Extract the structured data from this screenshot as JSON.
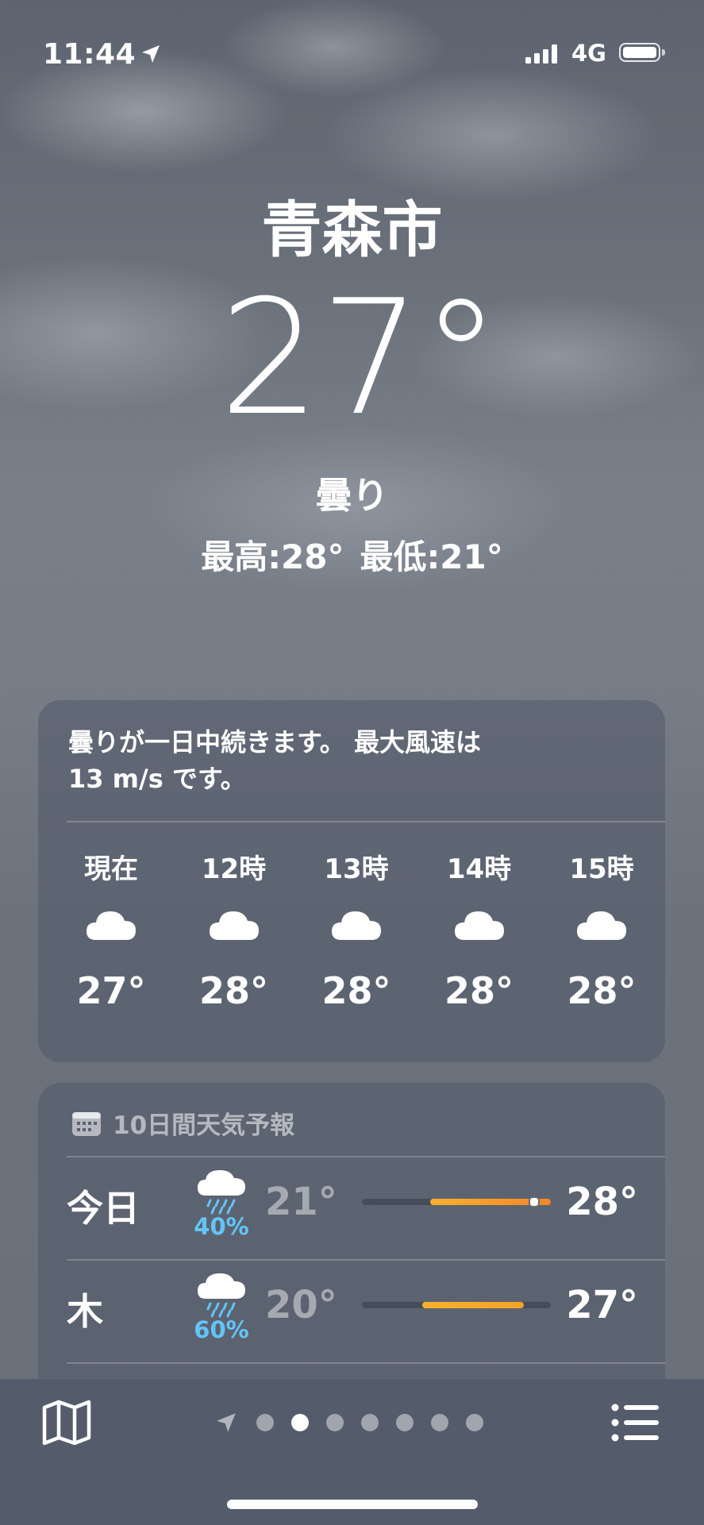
{
  "status_bar": {
    "time": "11:44",
    "network": "4G"
  },
  "location": {
    "city": "青森市",
    "temperature": "27°",
    "condition": "曇り",
    "high": "最高:28°",
    "low": "最低:21°"
  },
  "hourly_card": {
    "summary_line1": "曇りが一日中続きます。 最大風速は",
    "summary_line2": "13 m/s です。",
    "hours": [
      {
        "label": "現在",
        "icon": "cloud-icon",
        "temp": "27°"
      },
      {
        "label": "12時",
        "icon": "cloud-icon",
        "temp": "28°"
      },
      {
        "label": "13時",
        "icon": "cloud-icon",
        "temp": "28°"
      },
      {
        "label": "14時",
        "icon": "cloud-icon",
        "temp": "28°"
      },
      {
        "label": "15時",
        "icon": "cloud-icon",
        "temp": "28°"
      }
    ]
  },
  "forecast_card": {
    "title": "10日間天気予報",
    "days": [
      {
        "day": "今日",
        "icon": "cloud-rain-icon",
        "precip": "40%",
        "low": "21°",
        "high": "28°",
        "current_marker": true
      },
      {
        "day": "木",
        "icon": "cloud-rain-icon",
        "precip": "60%",
        "low": "20°",
        "high": "27°",
        "current_marker": false
      }
    ]
  },
  "toolbar": {
    "map_icon": "map-icon",
    "list_icon": "list-icon",
    "pages": 7,
    "active_page": 2
  },
  "colors": {
    "precip": "#63c5f7",
    "bar_warm_start": "#f8b02b",
    "bar_warm_end": "#f5862a"
  }
}
